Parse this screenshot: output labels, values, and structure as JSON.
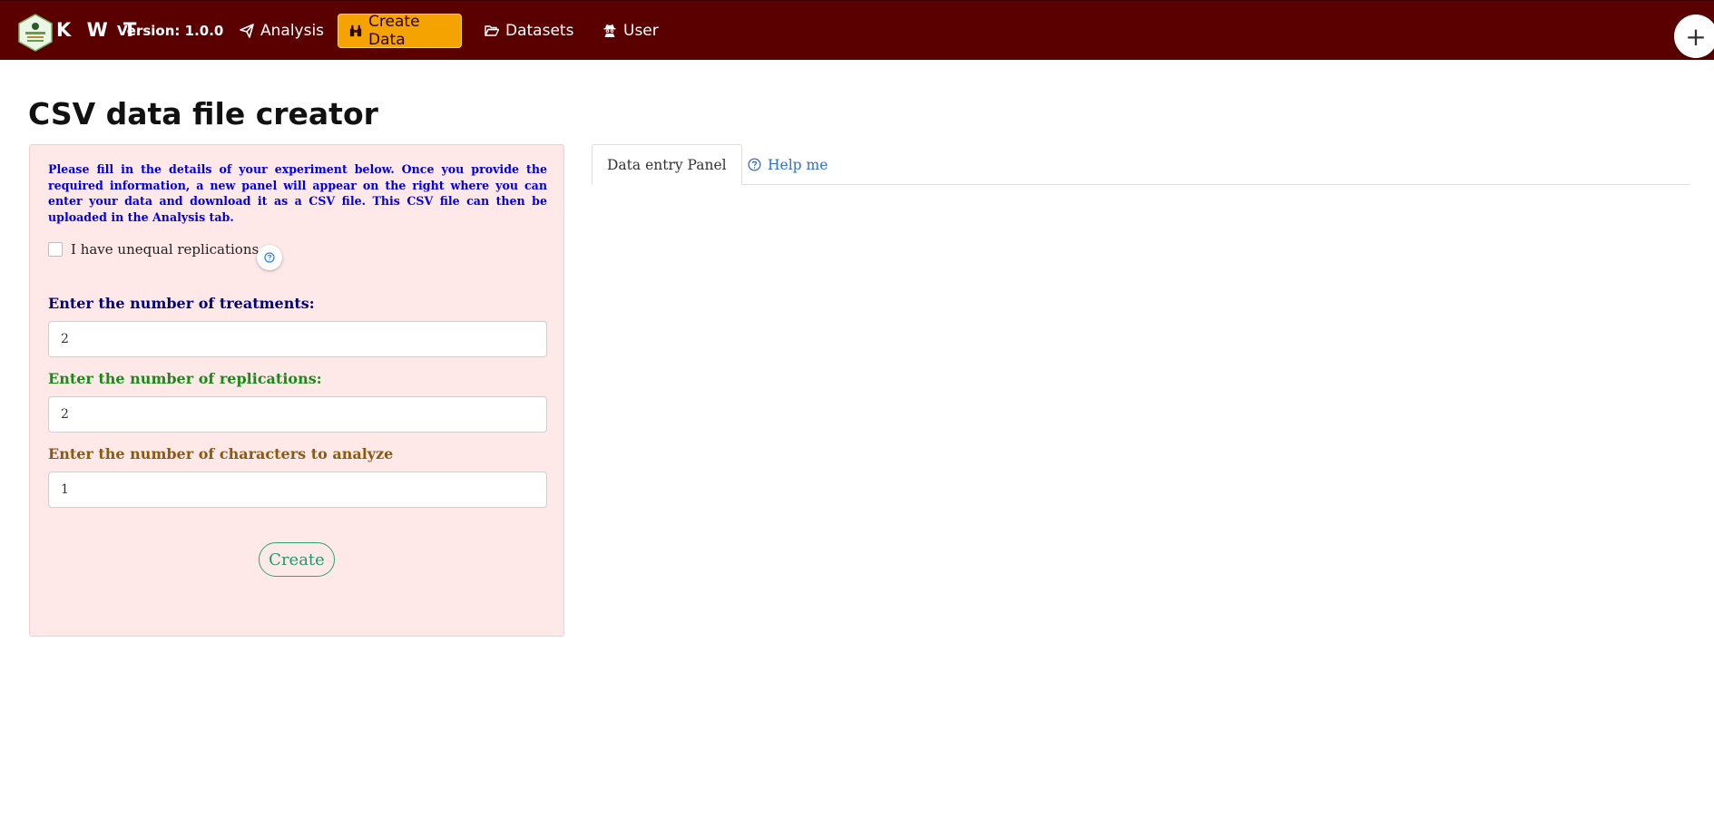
{
  "navbar": {
    "brand": "K W T",
    "version": "Version: 1.0.0",
    "items": [
      {
        "label": "Analysis",
        "icon": "paper-plane-icon"
      },
      {
        "label": "Create Data",
        "icon": "binoculars-icon",
        "active": true
      },
      {
        "label": "Datasets",
        "icon": "folder-open-icon"
      },
      {
        "label": "User",
        "icon": "user-secret-icon"
      }
    ],
    "fab_label": "+"
  },
  "page": {
    "title": "CSV data file creator"
  },
  "form": {
    "intro": "Please fill in the details of your experiment below. Once you provide the required information, a new panel will appear on the right where you can enter your data and download it as a CSV file. This CSV file can then be uploaded in the Analysis tab.",
    "unequal_label": "I have unequal replications",
    "unequal_checked": false,
    "treatments_label": "Enter the number of treatments:",
    "treatments_value": "2",
    "replications_label": "Enter the number of replications:",
    "replications_value": "2",
    "characters_label": "Enter the number of characters to analyze",
    "characters_value": "1",
    "create_label": "Create"
  },
  "tabs": [
    {
      "label": "Data entry Panel",
      "active": true
    },
    {
      "label": "Help me",
      "icon": "question-circle-icon"
    }
  ],
  "colors": {
    "navbar": "#5a0000",
    "active_nav": "#f5a300",
    "panel": "#ffe8e8",
    "intro_text": "#0000e6",
    "link": "#2f6fd6",
    "create": "#1f9a6e"
  }
}
